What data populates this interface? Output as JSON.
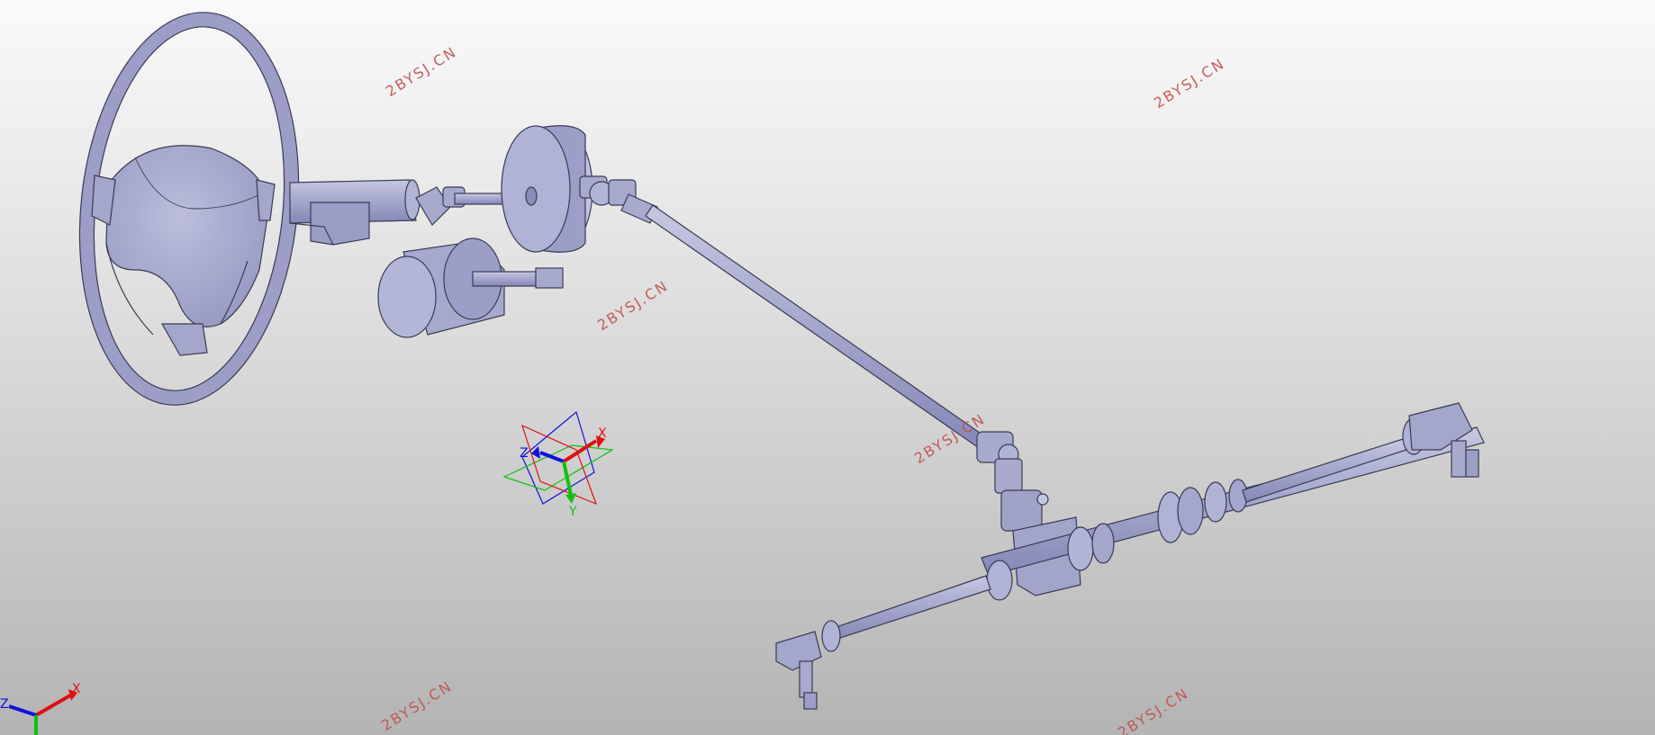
{
  "viewport": {
    "background_top": "#fafafa",
    "background_bottom": "#b4b4b4",
    "model_color": "#a8aacd",
    "edge_color": "#3a3b55"
  },
  "watermarks": [
    {
      "text": "2BYSJ.CN"
    },
    {
      "text": "2BYSJ.CN"
    },
    {
      "text": "2BYSJ.CN"
    },
    {
      "text": "2BYSJ.CN"
    },
    {
      "text": "2BYSJ.CN"
    },
    {
      "text": "2BYSJ.CN"
    }
  ],
  "watermark_color": "#c0504d",
  "compass": {
    "x_label": "X",
    "y_label": "Y",
    "z_label": "Z"
  },
  "corner_triad": {
    "x_label": "X",
    "z_label": "Z"
  },
  "axis_colors": {
    "x": "#e01010",
    "y": "#10c010",
    "z": "#1010e0"
  }
}
